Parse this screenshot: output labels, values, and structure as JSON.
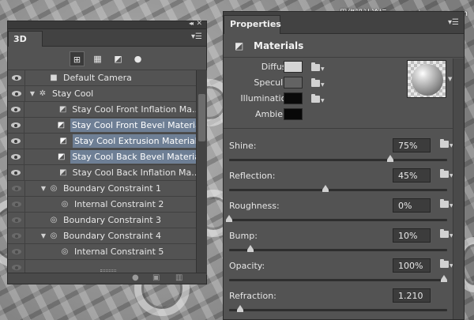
{
  "watermark": "思缘设计论坛 www.missyuan.com",
  "panel3d": {
    "tab_label": "3D",
    "menu_icon": "panel-menu-icon",
    "filter_icons": [
      "whole-scene-icon",
      "meshes-icon",
      "materials-icon",
      "lights-icon"
    ],
    "layers": [
      {
        "name": "Default Camera",
        "visible": true,
        "icon": "camera-icon",
        "indent": 1,
        "twirl": "",
        "selected": false
      },
      {
        "name": "Stay  Cool",
        "visible": true,
        "icon": "mesh-icon",
        "indent": 0,
        "twirl": "▼",
        "selected": false
      },
      {
        "name": "Stay  Cool Front Inflation Ma...",
        "visible": true,
        "icon": "material-icon",
        "indent": 2,
        "twirl": "",
        "selected": false
      },
      {
        "name": "Stay  Cool Front Bevel Material",
        "visible": true,
        "icon": "material-icon",
        "indent": 2,
        "twirl": "",
        "selected": true
      },
      {
        "name": "Stay  Cool Extrusion Material",
        "visible": true,
        "icon": "material-icon",
        "indent": 2,
        "twirl": "",
        "selected": true
      },
      {
        "name": "Stay  Cool Back Bevel Material",
        "visible": true,
        "icon": "material-icon",
        "indent": 2,
        "twirl": "",
        "selected": true
      },
      {
        "name": "Stay  Cool Back Inflation Ma...",
        "visible": true,
        "icon": "material-icon",
        "indent": 2,
        "twirl": "",
        "selected": false
      },
      {
        "name": "Boundary Constraint 1",
        "visible": false,
        "icon": "constraint-icon",
        "indent": 1,
        "twirl": "▼",
        "selected": false
      },
      {
        "name": "Internal Constraint 2",
        "visible": false,
        "icon": "constraint-icon",
        "indent": 2,
        "twirl": "",
        "selected": false
      },
      {
        "name": "Boundary Constraint 3",
        "visible": false,
        "icon": "constraint-icon",
        "indent": 1,
        "twirl": "",
        "selected": false
      },
      {
        "name": "Boundary Constraint 4",
        "visible": false,
        "icon": "constraint-icon",
        "indent": 1,
        "twirl": "▼",
        "selected": false
      },
      {
        "name": "Internal Constraint 5",
        "visible": false,
        "icon": "constraint-icon",
        "indent": 2,
        "twirl": "",
        "selected": false
      },
      {
        "name": "",
        "visible": false,
        "icon": "",
        "indent": 1,
        "twirl": "",
        "selected": false
      }
    ],
    "bottom_icons": [
      "light-bulb-icon",
      "render-icon",
      "trash-icon"
    ]
  },
  "properties": {
    "tab_label": "Properties",
    "header_title": "Materials",
    "material_rows": [
      {
        "label": "Diffuse:",
        "color": "#d4d4d4",
        "has_folder": true
      },
      {
        "label": "Specular:",
        "color": "#636363",
        "has_folder": true
      },
      {
        "label": "Illumination:",
        "color": "#0a0a0a",
        "has_folder": true
      },
      {
        "label": "Ambient:",
        "color": "#080808",
        "has_folder": false
      }
    ],
    "params": [
      {
        "label": "Shine:",
        "value": "75%",
        "slider": 0.75
      },
      {
        "label": "Reflection:",
        "value": "45%",
        "slider": 0.45
      },
      {
        "label": "Roughness:",
        "value": "0%",
        "slider": 0.0
      },
      {
        "label": "Bump:",
        "value": "10%",
        "slider": 0.1
      },
      {
        "label": "Opacity:",
        "value": "100%",
        "slider": 1.0
      },
      {
        "label": "Refraction:",
        "value": "1.210",
        "slider": 0.05
      }
    ]
  }
}
